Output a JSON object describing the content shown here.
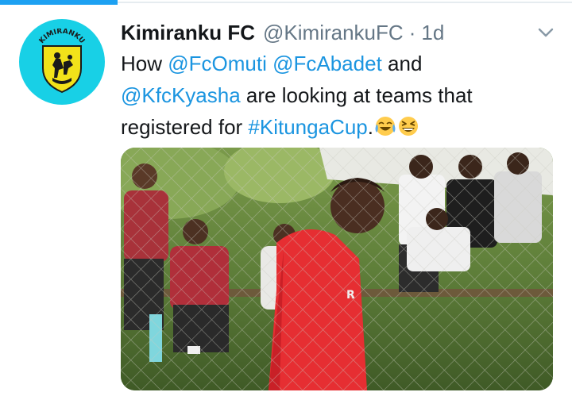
{
  "header": {
    "display_name": "Kimiranku FC",
    "handle": "@KimirankuFC",
    "separator": "·",
    "timestamp": "1d"
  },
  "avatar": {
    "logo_text": "KIMIRANKU"
  },
  "tweet": {
    "line1_prefix": "How ",
    "mention1": "@FcOmuti",
    "space1": " ",
    "mention2": "@FcAbadet",
    "line1_suffix": " and",
    "mention3": "@KfcKyasha",
    "line2_suffix": " are looking at teams that",
    "line3_prefix": "registered for ",
    "hashtag": "#KitungaCup",
    "period": ".",
    "emojis": [
      "face-with-tears-of-joy",
      "grinning-squinting-face"
    ]
  },
  "photo": {
    "description_tag": "football-spectators-photo",
    "shirt_text": "R"
  },
  "colors": {
    "link": "#1b95e0",
    "text": "#14171a",
    "secondary": "#657786",
    "accent_bar": "#1da1f2",
    "avatar_bg": "#18d0e6"
  }
}
